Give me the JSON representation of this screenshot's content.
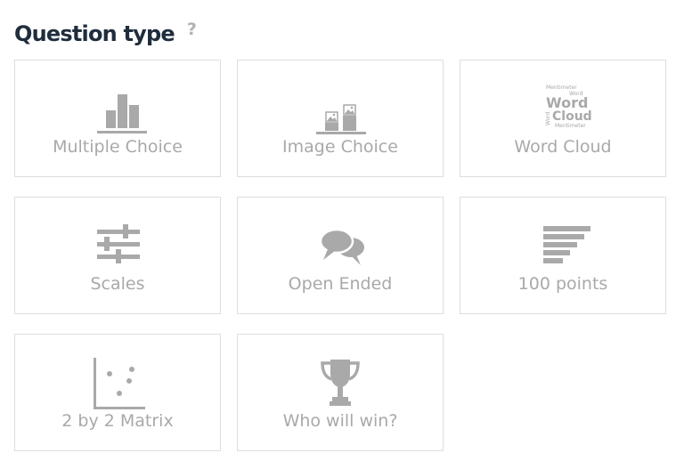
{
  "header": {
    "title": "Question type",
    "help_label": "?"
  },
  "colors": {
    "title": "#1f2d3d",
    "icon": "#a9a9a9",
    "label": "#a9a9a9",
    "border": "#dedede",
    "help": "#b2b2b2"
  },
  "tiles": [
    {
      "label": "Multiple Choice",
      "icon": "bar-chart-icon"
    },
    {
      "label": "Image Choice",
      "icon": "image-bars-icon"
    },
    {
      "label": "Word Cloud",
      "icon": "word-cloud-icon",
      "icon_words": [
        "Mentimeter",
        "Word",
        "Word",
        "Cloud",
        "Word",
        "Mentimeter"
      ]
    },
    {
      "label": "Scales",
      "icon": "sliders-icon"
    },
    {
      "label": "Open Ended",
      "icon": "speech-bubbles-icon"
    },
    {
      "label": "100 points",
      "icon": "horizontal-bars-icon"
    },
    {
      "label": "2 by 2 Matrix",
      "icon": "scatter-plot-icon"
    },
    {
      "label": "Who will win?",
      "icon": "trophy-icon"
    }
  ]
}
